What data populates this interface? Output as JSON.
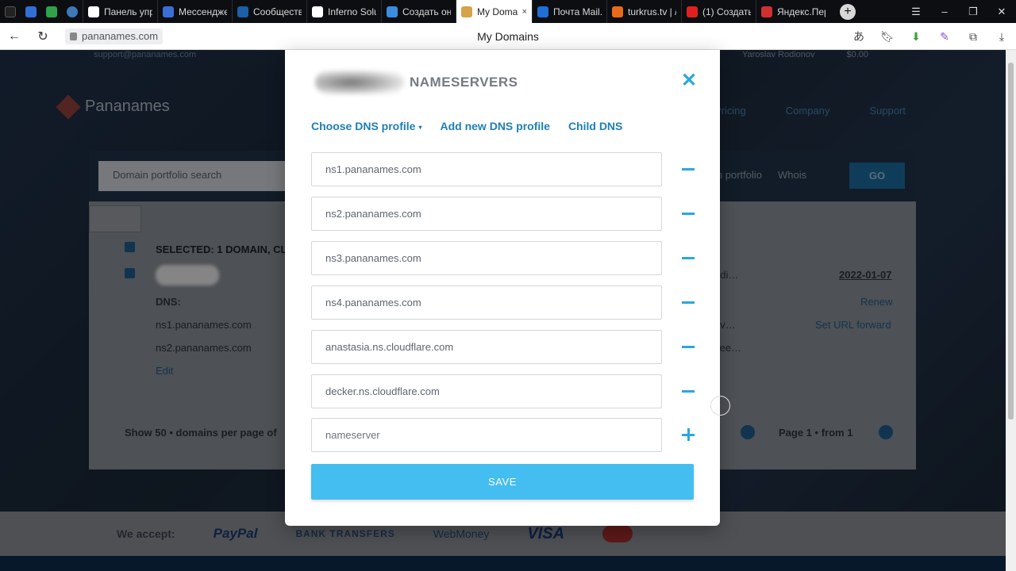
{
  "browser": {
    "tabs": [
      {
        "label": "Панель упр",
        "color": "#ffffff"
      },
      {
        "label": "Мессендже",
        "color": "#3b6fd8"
      },
      {
        "label": "Сообществ",
        "color": "#1b5fa8"
      },
      {
        "label": "Inferno Solu",
        "color": "#ffffff"
      },
      {
        "label": "Создать он",
        "color": "#3a8de0"
      },
      {
        "label": "My Doma",
        "color": "#d6a24a"
      },
      {
        "label": "Почта Mail.",
        "color": "#1f6fd8"
      },
      {
        "label": "turkrus.tv | /",
        "color": "#e86a1a"
      },
      {
        "label": "(1) Создать",
        "color": "#e02020"
      },
      {
        "label": "Яндекс.Пер",
        "color": "#d23030"
      }
    ],
    "active_tab_close": "×",
    "new_tab": "+",
    "url": "pananames.com",
    "page_title": "My Domains"
  },
  "site": {
    "support_email": "support@pananames.com",
    "user_name": "Yaroslav Rodionov",
    "balance": "$0.00",
    "logo_text": "Pananames",
    "nav": [
      "Pricing",
      "Company",
      "Support"
    ],
    "search_placeholder": "Domain portfolio search",
    "search_options": [
      "in portfolio",
      "Whois"
    ],
    "go_label": "GO",
    "selected_text": "SELECTED: 1 DOMAIN, CL",
    "dns_label": "DNS:",
    "dns_values": [
      "ns1.pananames.com",
      "ns2.pananames.com"
    ],
    "edit_label": "Edit",
    "expiry_date": "2022-01-07",
    "actions": [
      "Renew",
      "Set URL forward"
    ],
    "truncated_cells": [
      "odi…",
      "ov…",
      "see…"
    ],
    "pagination_left": "Show 50 • domains per page of",
    "pagination_right": "Page 1 • from 1",
    "footer": {
      "we_accept": "We accept:",
      "paypal": "PayPal",
      "bank": "BANK TRANSFERS",
      "webmoney": "WebMoney",
      "visa": "VISA"
    }
  },
  "modal": {
    "title": "NAMESERVERS",
    "links": {
      "choose_profile": "Choose DNS profile",
      "caret": "▾",
      "add_profile": "Add new DNS profile",
      "child_dns": "Child DNS"
    },
    "nameservers": [
      "ns1.pananames.com",
      "ns2.pananames.com",
      "ns3.pananames.com",
      "ns4.pananames.com",
      "anastasia.ns.cloudflare.com",
      "decker.ns.cloudflare.com"
    ],
    "new_placeholder": "nameserver",
    "save_label": "SAVE",
    "accent": "#2aa7dd",
    "save_color": "#44bdf0"
  }
}
